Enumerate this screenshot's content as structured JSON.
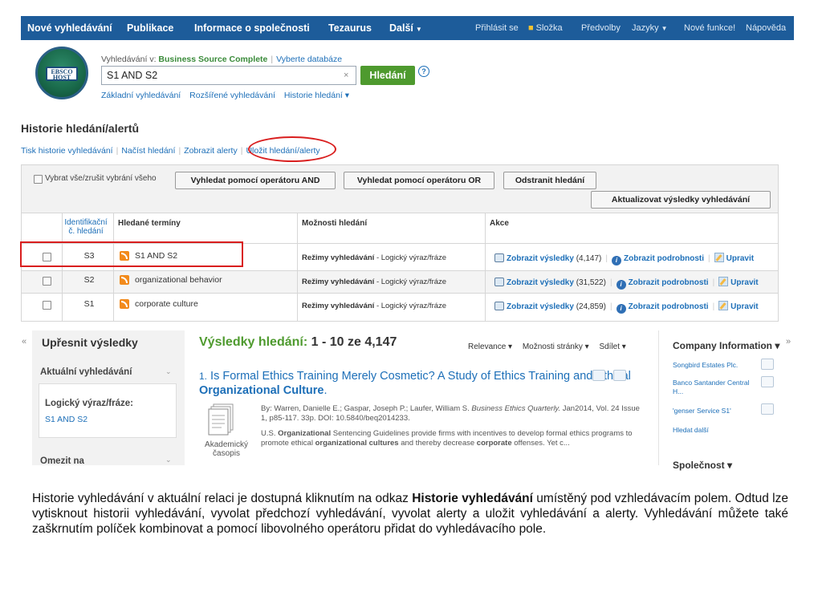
{
  "nav": {
    "items": [
      "Nové vyhledávání",
      "Publikace",
      "Informace o společnosti",
      "Tezaurus",
      "Další"
    ],
    "right": [
      "Přihlásit se",
      "Složka",
      "Předvolby",
      "Jazyky",
      "Nové funkce!",
      "Nápověda"
    ],
    "bg": "#1d5c9a"
  },
  "header": {
    "logo_text": "EBSCO HOST",
    "searching_prefix": "Vyhledávání v:",
    "database": "Business Source Complete",
    "choose_db": "Vyberte databáze",
    "query": "S1 AND S2",
    "clear": "×",
    "search_button": "Hledání",
    "help": "?",
    "links": [
      "Základní vyhledávání",
      "Rozšířené vyhledávání",
      "Historie hledání ▾"
    ]
  },
  "history": {
    "title": "Historie hledání/alertů",
    "links": [
      "Tisk historie vyhledávání",
      "Načíst hledání",
      "Zobrazit alerty",
      "Uložit hledání/alerty"
    ],
    "select_all": "Vybrat vše/zrušit vybrání všeho",
    "btn_and": "Vyhledat pomocí operátoru AND",
    "btn_or": "Vyhledat pomocí operátoru OR",
    "btn_remove": "Odstranit hledání",
    "btn_refresh": "Aktualizovat výsledky vyhledávání",
    "col_id": "Identifikační č. hledání",
    "col_terms": "Hledané termíny",
    "col_options": "Možnosti hledání",
    "col_actions": "Akce",
    "rows": [
      {
        "id": "S3",
        "terms": "S1 AND S2",
        "mode_label": "Režimy vyhledávání",
        "mode_value": "- Logický výraz/fráze",
        "view": "Zobrazit výsledky",
        "count": "(4,147)",
        "details": "Zobrazit podrobnosti",
        "edit": "Upravit"
      },
      {
        "id": "S2",
        "terms": "organizational behavior",
        "mode_label": "Režimy vyhledávání",
        "mode_value": "- Logický výraz/fráze",
        "view": "Zobrazit výsledky",
        "count": "(31,522)",
        "details": "Zobrazit podrobnosti",
        "edit": "Upravit"
      },
      {
        "id": "S1",
        "terms": "corporate culture",
        "mode_label": "Režimy vyhledávání",
        "mode_value": "- Logický výraz/fráze",
        "view": "Zobrazit výsledky",
        "count": "(24,859)",
        "details": "Zobrazit podrobnosti",
        "edit": "Upravit"
      }
    ]
  },
  "refine": {
    "title": "Upřesnit výsledky",
    "current": "Aktuální vyhledávání",
    "bool_label": "Logický výraz/fráze:",
    "bool_value": "S1 AND S2",
    "limit": "Omezit na",
    "left_chev": "«",
    "right_chev": "»"
  },
  "results": {
    "title": "Výsledky hledání:",
    "range": "1 - 10 ze 4,147",
    "sort": [
      "Relevance ▾",
      "Možnosti stránky ▾",
      "Sdílet ▾"
    ],
    "item_number": "1.",
    "item_title_a": "Is Formal Ethics Training Merely Cosmetic? A Study of Ethics Training and Ethical",
    "item_title_b": "Organizational Culture",
    "item_title_end": ".",
    "meta_prefix": "By: Warren, Danielle E.; Gaspar, Joseph P.; Laufer, William S.",
    "meta_journal": "Business Ethics Quarterly.",
    "meta_suffix": "Jan2014, Vol. 24 Issue 1, p85-117. 33p. DOI: 10.5840/beq2014233.",
    "abstract_1": "U.S.",
    "abstract_2": "Organizational",
    "abstract_3": "Sentencing Guidelines provide firms with incentives to develop formal ethics programs to promote ethical",
    "abstract_4": "organizational cultures",
    "abstract_5": "and thereby decrease",
    "abstract_6": "corporate",
    "abstract_7": "offenses. Yet c...",
    "doc_type": "Akademický časopis"
  },
  "company": {
    "title": "Company Information ▾",
    "items": [
      "Songbird Estates Plc.",
      "Banco Santander Central H...",
      "'genser Service S1'"
    ],
    "more": "Hledat další",
    "section": "Společnost ▾"
  },
  "description": {
    "before": "Historie vyhledávání v aktuální relaci je dostupná kliknutím na odkaz",
    "bold": "Historie vyhledávání",
    "after": "umístěný pod vzhledávacím polem. Odtud lze vytisknout historii vyhledávání, vyvolat předchozí vyhledávání, vyvolat alerty a uložit vyhledávání a alerty. Vyhledávání můžete také zaškrnutím políček kombinovat a pomocí libovolného operátoru přidat do vyhledávacího pole."
  }
}
